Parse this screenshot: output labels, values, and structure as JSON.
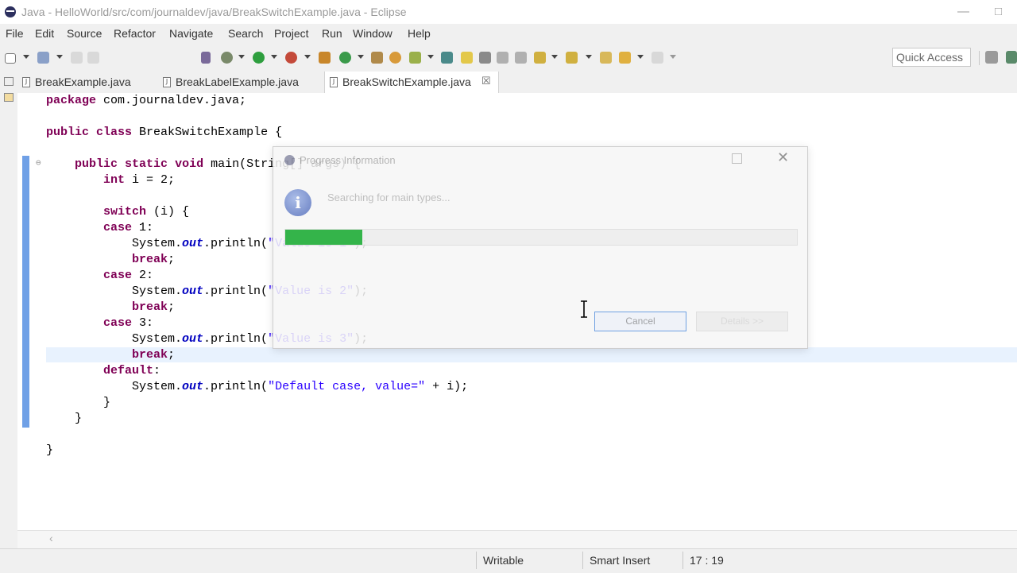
{
  "window": {
    "title": "Java - HelloWorld/src/com/journaldev/java/BreakSwitchExample.java - Eclipse",
    "controls": [
      "—",
      "□"
    ]
  },
  "menu": [
    "File",
    "Edit",
    "Source",
    "Refactor",
    "Navigate",
    "Search",
    "Project",
    "Run",
    "Window",
    "Help"
  ],
  "toolbar": {
    "quick_access": "Quick Access",
    "icons": [
      "new-icon",
      "save-icon",
      "print-icon",
      "debug-icon",
      "run-icon",
      "coverage-icon",
      "external-tools-icon",
      "new-java-project-icon",
      "new-package-icon",
      "new-class-icon",
      "open-type-icon",
      "search-icon",
      "next-annotation-icon",
      "previous-annotation-icon",
      "back-icon",
      "forward-icon"
    ]
  },
  "tabs": [
    {
      "label": "BreakExample.java",
      "active": false
    },
    {
      "label": "BreakLabelExample.java",
      "active": false
    },
    {
      "label": "BreakSwitchExample.java",
      "active": true,
      "close": "☒"
    }
  ],
  "code": [
    "package com.journaldev.java;",
    "",
    "public class BreakSwitchExample {",
    "",
    "    public static void main(String[] args) {",
    "        int i = 2;",
    "",
    "        switch (i) {",
    "        case 1:",
    "            System.out.println(\"Value is 1\");",
    "            break;",
    "        case 2:",
    "            System.out.println(\"Value is 2\");",
    "            break;",
    "        case 3:",
    "            System.out.println(\"Value is 3\");",
    "            break;",
    "        default:",
    "            System.out.println(\"Default case, value=\" + i);",
    "        }",
    "    }",
    "",
    "}"
  ],
  "status": {
    "writable": "Writable",
    "insert_mode": "Smart Insert",
    "position": "17 : 19"
  },
  "dialog": {
    "title": "Progress Information",
    "message": "Searching for main types...",
    "progress": 0.15,
    "cancel_label": "Cancel",
    "details_label": "Details >>",
    "close": "✕",
    "info_glyph": "i"
  },
  "colors": {
    "keyword": "#7f0055",
    "field": "#0000c0",
    "string": "#2a00ff",
    "progress": "#34b44a",
    "gutter_marker": "#6fa0e6",
    "current_line": "#e8f2fe"
  }
}
